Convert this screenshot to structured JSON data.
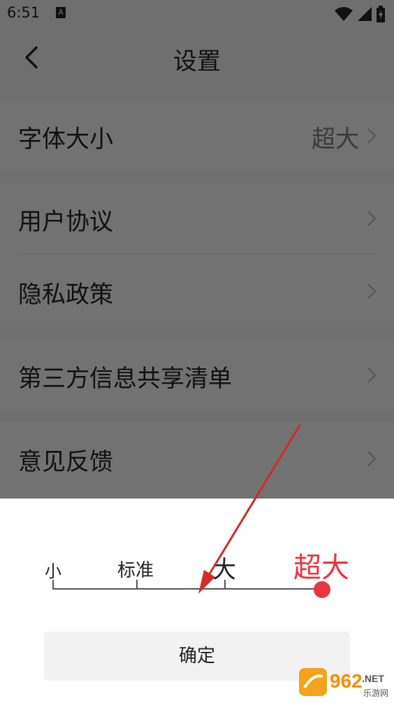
{
  "status_bar": {
    "time": "6:51",
    "notification_icon": "A"
  },
  "header": {
    "title": "设置",
    "back_icon": "chevron-left-icon"
  },
  "settings": {
    "font_size": {
      "label": "字体大小",
      "value": "超大"
    },
    "user_agreement": {
      "label": "用户协议"
    },
    "privacy_policy": {
      "label": "隐私政策"
    },
    "third_party_list": {
      "label": "第三方信息共享清单"
    },
    "feedback": {
      "label": "意见反馈"
    }
  },
  "font_sheet": {
    "levels": [
      "小",
      "标准",
      "大",
      "超大"
    ],
    "selected_level": "超大",
    "selected_index": 3,
    "accent_color": "#e8353f",
    "confirm_label": "确定"
  },
  "watermark": {
    "text": "962",
    "suffix": ".NET",
    "subtitle": "乐游网"
  }
}
